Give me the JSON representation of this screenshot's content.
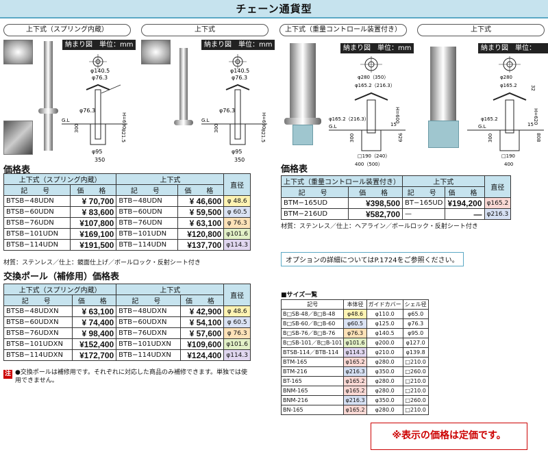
{
  "title": "チェーン通貨型",
  "pills": [
    "上下式（スプリング内蔵）",
    "上下式",
    "上下式（重量コントロール装置付き）",
    "上下式"
  ],
  "drawing_label": "納まり図　単位：mm",
  "drawings": [
    {
      "top1": "φ140.5",
      "top2": "φ76.3",
      "mid": "φ76.3",
      "h": "H=690",
      "gl": "G.L",
      "d300": "300",
      "d821": "821.5",
      "b1": "φ95",
      "b2": "350"
    },
    {
      "top1": "φ140.5",
      "top2": "φ76.3",
      "mid": "φ76.3",
      "h": "H=690",
      "gl": "G.L",
      "d300": "300",
      "d821": "821.5",
      "b1": "φ95",
      "b2": "350"
    },
    {
      "top1": "φ280（350）",
      "top2": "φ165.2（216.3）",
      "mid": "φ165.2（216.3）",
      "h": "H=600",
      "gl": "G.L",
      "d15": "15",
      "d300": "300",
      "d929": "929",
      "b1": "□190（240）",
      "b2": "400（500）"
    },
    {
      "top1": "φ280",
      "top2": "φ165.2",
      "mid": "φ165.2",
      "h": "H=620",
      "gl": "G.L",
      "d15": "15",
      "d32": "32",
      "d300": "300",
      "d808": "808",
      "b1": "□190",
      "b2": "400"
    }
  ],
  "price_title_1": "価格表",
  "price_title_2": "価格表",
  "table1": {
    "h1": "上下式（スプリング内蔵）",
    "h2": "上下式",
    "h3": "直径",
    "sub": [
      "記　号",
      "価　格",
      "記　号",
      "価　格"
    ],
    "rows": [
      {
        "c1": "BTSB−48UDN",
        "p1": "¥ 70,700",
        "c2": "BTB−48UDN",
        "p2": "¥ 46,600",
        "d": "φ 48.6",
        "cls": "c48"
      },
      {
        "c1": "BTSB−60UDN",
        "p1": "¥ 83,600",
        "c2": "BTB−60UDN",
        "p2": "¥ 59,500",
        "d": "φ 60.5",
        "cls": "c60"
      },
      {
        "c1": "BTSB−76UDN",
        "p1": "¥107,800",
        "c2": "BTB−76UDN",
        "p2": "¥ 63,100",
        "d": "φ 76.3",
        "cls": "c76"
      },
      {
        "c1": "BTSB−101UDN",
        "p1": "¥169,100",
        "c2": "BTB−101UDN",
        "p2": "¥120,800",
        "d": "φ101.6",
        "cls": "c101"
      },
      {
        "c1": "BTSB−114UDN",
        "p1": "¥191,500",
        "c2": "BTB−114UDN",
        "p2": "¥137,700",
        "d": "φ114.3",
        "cls": "c114"
      }
    ],
    "note": "材質：ステンレス／仕上：鏡面仕上げ／ボールロック・反射シート付き"
  },
  "table2_title": "交換ポール（補修用）価格表",
  "table2": {
    "h1": "上下式（スプリング内蔵）",
    "h2": "上下式",
    "h3": "直径",
    "sub": [
      "記　号",
      "価　格",
      "記　号",
      "価　格"
    ],
    "rows": [
      {
        "c1": "BTSB−48UDXN",
        "p1": "¥ 63,100",
        "c2": "BTB−48UDXN",
        "p2": "¥ 42,900",
        "d": "φ 48.6",
        "cls": "c48"
      },
      {
        "c1": "BTSB−60UDXN",
        "p1": "¥ 74,400",
        "c2": "BTB−60UDXN",
        "p2": "¥ 54,100",
        "d": "φ 60.5",
        "cls": "c60"
      },
      {
        "c1": "BTSB−76UDXN",
        "p1": "¥ 98,400",
        "c2": "BTB−76UDXN",
        "p2": "¥ 57,600",
        "d": "φ 76.3",
        "cls": "c76"
      },
      {
        "c1": "BTSB−101UDXN",
        "p1": "¥152,400",
        "c2": "BTB−101UDXN",
        "p2": "¥109,600",
        "d": "φ101.6",
        "cls": "c101"
      },
      {
        "c1": "BTSB−114UDXN",
        "p1": "¥172,700",
        "c2": "BTB−114UDXN",
        "p2": "¥124,400",
        "d": "φ114.3",
        "cls": "c114"
      }
    ]
  },
  "caution_mark": "注",
  "caution_text": "●交換ポールは補修用です。それぞれに対応した商品のみ補修できます。単独では使用できません。",
  "table3": {
    "h1": "上下式（重量コントロール装置付き）",
    "h2": "上下式",
    "h3": "直径",
    "sub": [
      "記　号",
      "価　格",
      "記　号",
      "価　格"
    ],
    "rows": [
      {
        "c1": "BTM−165UD",
        "p1": "¥398,500",
        "c2": "BT−165UD",
        "p2": "¥194,200",
        "d": "φ165.2",
        "cls": "c165"
      },
      {
        "c1": "BTM−216UD",
        "p1": "¥582,700",
        "c2": "—",
        "p2": "—",
        "d": "φ216.3",
        "cls": "c216"
      }
    ],
    "note": "材質：ステンレス／仕上：ヘアライン／ボールロック・反射シート付き"
  },
  "option_note": "オプションの詳細についてはP.1724をご参照ください。",
  "size_title": "■サイズ一覧",
  "size_table": {
    "headers": [
      "記号",
      "本体径",
      "ガイドカバー",
      "シェル径"
    ],
    "rows": [
      {
        "code": "B□SB-48／B□B-48",
        "body": "φ48.6",
        "guide": "φ110.0",
        "shell": "φ65.0",
        "cls": "c48"
      },
      {
        "code": "B□SB-60／B□B-60",
        "body": "φ60.5",
        "guide": "φ125.0",
        "shell": "φ76.3",
        "cls": "c60"
      },
      {
        "code": "B□SB-76／B□B-76",
        "body": "φ76.3",
        "guide": "φ140.5",
        "shell": "φ95.0",
        "cls": "c76"
      },
      {
        "code": "B□SB-101／B□B-101",
        "body": "φ101.6",
        "guide": "φ200.0",
        "shell": "φ127.0",
        "cls": "c101"
      },
      {
        "code": "BTSB-114／BTB-114",
        "body": "φ114.3",
        "guide": "φ210.0",
        "shell": "φ139.8",
        "cls": "c114"
      },
      {
        "code": "BTM-165",
        "body": "φ165.2",
        "guide": "φ280.0",
        "shell": "□210.0",
        "cls": "c165"
      },
      {
        "code": "BTM-216",
        "body": "φ216.3",
        "guide": "φ350.0",
        "shell": "□260.0",
        "cls": "c216"
      },
      {
        "code": "BT-165",
        "body": "φ165.2",
        "guide": "φ280.0",
        "shell": "□210.0",
        "cls": "c165"
      },
      {
        "code": "BNM-165",
        "body": "φ165.2",
        "guide": "φ280.0",
        "shell": "□210.0",
        "cls": "c165"
      },
      {
        "code": "BNM-216",
        "body": "φ216.3",
        "guide": "φ350.0",
        "shell": "□260.0",
        "cls": "c216"
      },
      {
        "code": "BN-165",
        "body": "φ165.2",
        "guide": "φ280.0",
        "shell": "□210.0",
        "cls": "c165"
      }
    ]
  },
  "warning": "※表示の価格は定価です。"
}
